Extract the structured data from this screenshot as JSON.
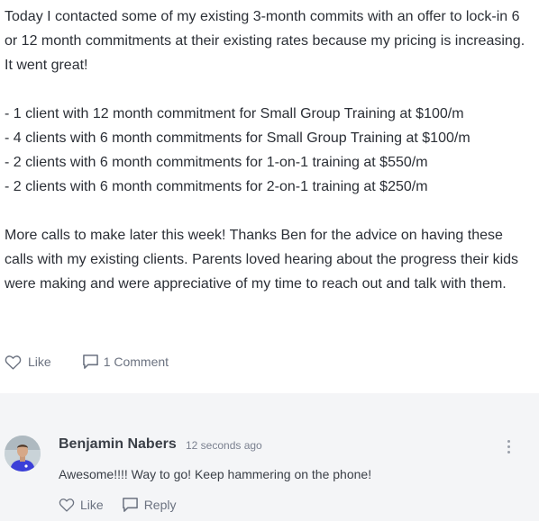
{
  "post": {
    "paragraph1": "Today I contacted some of my existing 3-month commits with an offer to lock-in 6 or 12 month commitments at their existing rates because my pricing is increasing. It went great!",
    "list": [
      "- 1 client with 12 month commitment for Small Group Training at $100/m",
      "- 4 clients with 6 month commitments for Small Group Training at $100/m",
      "- 2 clients with 6 month commitments for 1-on-1 training at $550/m",
      "- 2 clients with 6 month commitments for 2-on-1 training at $250/m"
    ],
    "paragraph2": "More calls to make later this week! Thanks Ben for the advice on having these calls with my existing clients. Parents loved hearing about the progress their kids were making and were appreciative of my time to reach out and talk with them.",
    "actions": {
      "like_label": "Like",
      "comment_label": "1 Comment"
    }
  },
  "comment": {
    "author": "Benjamin Nabers",
    "time": "12 seconds ago",
    "text": "Awesome!!!! Way to go! Keep hammering on the phone!",
    "actions": {
      "like_label": "Like",
      "reply_label": "Reply"
    }
  },
  "icons": {
    "like": "heart-icon",
    "comment": "speech-bubble-icon",
    "more": "vertical-ellipsis-icon"
  },
  "colors": {
    "text": "#2b2f36",
    "muted": "#6b7280",
    "comment_background": "#f4f5f7",
    "avatar_shirt": "#3b3fd8"
  }
}
